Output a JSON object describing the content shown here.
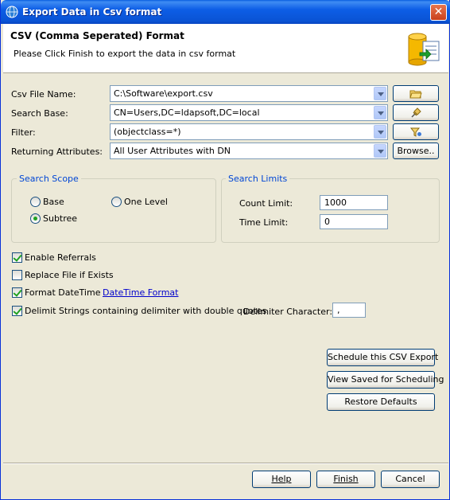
{
  "window": {
    "title": "Export Data in Csv format",
    "close_label": "✕"
  },
  "header": {
    "title": "CSV (Comma Seperated) Format",
    "description": "Please Click Finish to export the data in csv format"
  },
  "fields": {
    "csv_file_name": {
      "label": "Csv File Name:",
      "value": "C:\\Software\\export.csv"
    },
    "search_base": {
      "label": "Search Base:",
      "value": "CN=Users,DC=ldapsoft,DC=local"
    },
    "filter": {
      "label": "Filter:",
      "value": "(objectclass=*)"
    },
    "returning_attributes": {
      "label": "Returning Attributes:",
      "value": "All User Attributes with DN",
      "browse_label": "Browse.."
    }
  },
  "search_scope": {
    "title": "Search Scope",
    "base_label": "Base",
    "one_level_label": "One Level",
    "subtree_label": "Subtree",
    "selected": "Subtree"
  },
  "search_limits": {
    "title": "Search Limits",
    "count_label": "Count Limit:",
    "count_value": "1000",
    "time_label": "Time Limit:",
    "time_value": "0"
  },
  "options": {
    "enable_referrals": {
      "label": "Enable Referrals",
      "checked": true
    },
    "replace_file": {
      "label": "Replace File if Exists",
      "checked": false
    },
    "format_datetime": {
      "label": "Format DateTime",
      "checked": true,
      "link": "DateTime Format"
    },
    "delimit_strings": {
      "label": "Delimit Strings containing delimiter with double quotes",
      "checked": true
    },
    "delimiter_label": "Delimiter Character:",
    "delimiter_value": ","
  },
  "actions": {
    "schedule": "Schedule this CSV Export",
    "view_saved": "View Saved for Scheduling",
    "restore": "Restore Defaults"
  },
  "footer": {
    "help": "Help",
    "finish": "Finish",
    "cancel": "Cancel"
  }
}
